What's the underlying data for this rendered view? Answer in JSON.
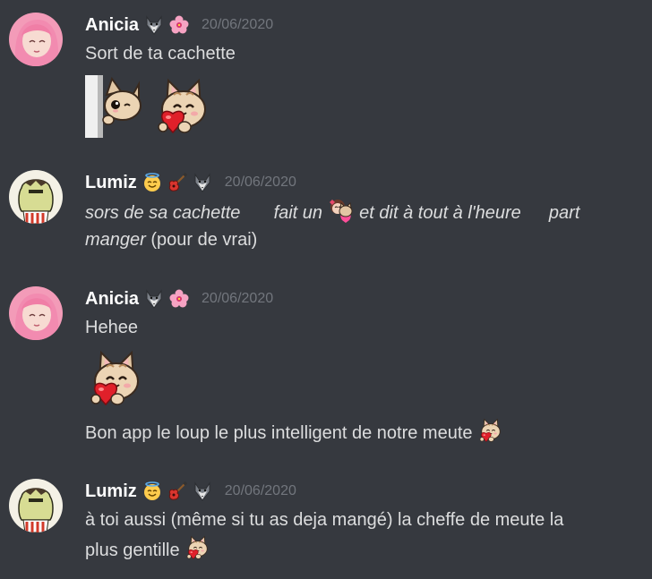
{
  "messages": [
    {
      "author": "Anicia",
      "badges": [
        "wolf-icon",
        "hibiscus-icon"
      ],
      "timestamp": "20/06/2020",
      "lines": [
        "Sort de ta cachette"
      ],
      "emojis": [
        "peeking-cat-emoji",
        "heart-cat-emoji"
      ]
    },
    {
      "author": "Lumiz",
      "badges": [
        "halo-smile-icon",
        "guitar-icon",
        "wolf-icon"
      ],
      "timestamp": "20/06/2020",
      "line1": {
        "part1": "sors de sa cachette",
        "part2": "fait un",
        "part3": "et dit à tout à l'heure",
        "part4": "part"
      },
      "line2": {
        "italic": "manger",
        "normal": "(pour de vrai)"
      }
    },
    {
      "author": "Anicia",
      "badges": [
        "wolf-icon",
        "hibiscus-icon"
      ],
      "timestamp": "20/06/2020",
      "line1": "Hehee",
      "line2": "Bon app le loup le plus intelligent de notre meute"
    },
    {
      "author": "Lumiz",
      "badges": [
        "halo-smile-icon",
        "guitar-icon",
        "wolf-icon"
      ],
      "timestamp": "20/06/2020",
      "line1": "à toi  aussi (même si tu as deja mangé) la cheffe de meute la",
      "line2": "plus gentille"
    }
  ],
  "colors": {
    "background": "#36393f",
    "username": "#ffffff",
    "text": "#dcddde",
    "timestamp": "#72767d"
  }
}
